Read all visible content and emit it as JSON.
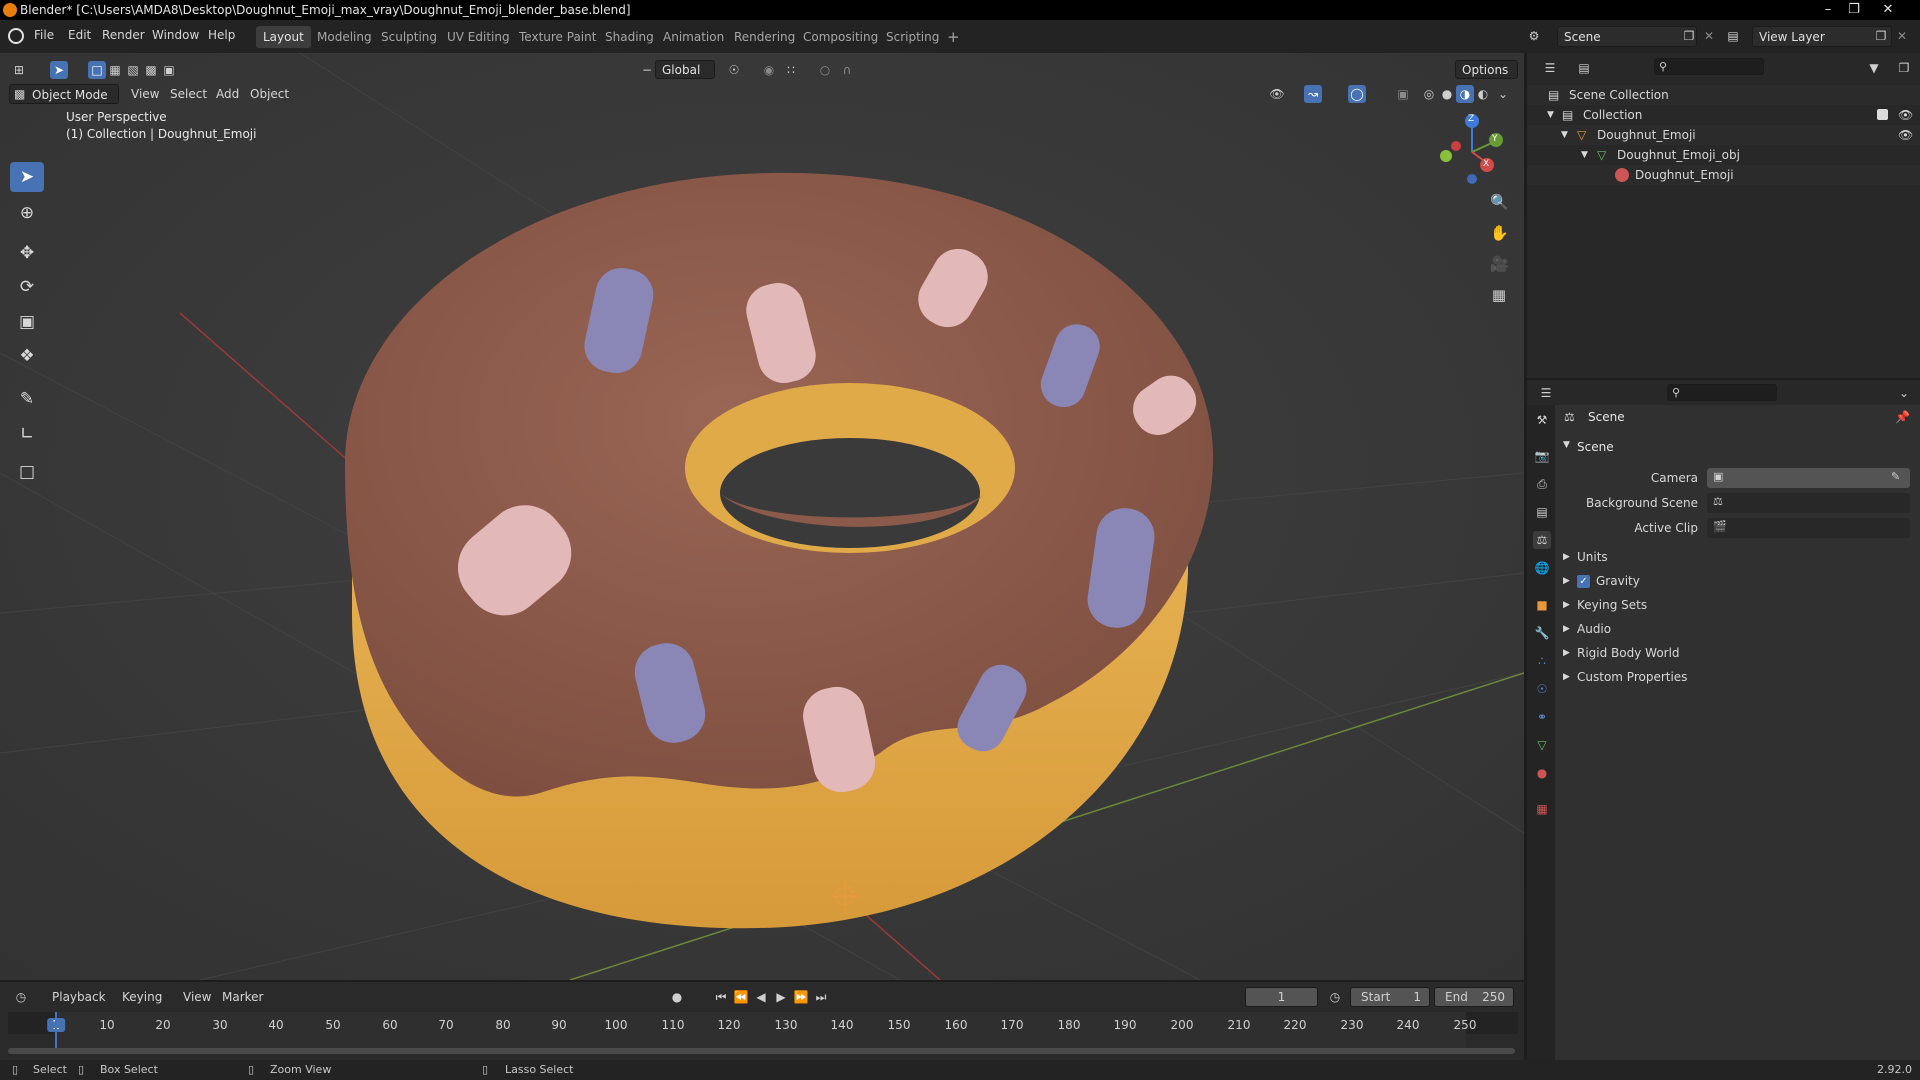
{
  "window": {
    "title": "Blender* [C:\\Users\\AMDA8\\Desktop\\Doughnut_Emoji_max_vray\\Doughnut_Emoji_blender_base.blend]",
    "minimize": "–",
    "maximize": "❐",
    "close": "✕"
  },
  "menu": {
    "items": [
      "File",
      "Edit",
      "Render",
      "Window",
      "Help"
    ]
  },
  "workspaces": [
    "Layout",
    "Modeling",
    "Sculpting",
    "UV Editing",
    "Texture Paint",
    "Shading",
    "Animation",
    "Rendering",
    "Compositing",
    "Scripting",
    "+"
  ],
  "scene_selector": {
    "value": "Scene",
    "viewlayer": "View Layer"
  },
  "viewport": {
    "orientation": "Global",
    "options_label": "Options",
    "mode": "Object Mode",
    "header_menus": [
      "View",
      "Select",
      "Add",
      "Object"
    ],
    "overlay_title": "User Perspective",
    "overlay_subtitle": "(1) Collection | Doughnut_Emoji",
    "gizmo": {
      "z": "Z",
      "y": "Y",
      "x": "X"
    }
  },
  "outliner": {
    "rows": [
      "Scene Collection",
      "Collection",
      "Doughnut_Emoji",
      "Doughnut_Emoji_obj",
      "Doughnut_Emoji"
    ]
  },
  "properties": {
    "context": "Scene",
    "section": "Scene",
    "fields": [
      {
        "label": "Camera",
        "value": ""
      },
      {
        "label": "Background Scene",
        "value": ""
      },
      {
        "label": "Active Clip",
        "value": ""
      }
    ],
    "panels": [
      "Units",
      "Gravity",
      "Keying Sets",
      "Audio",
      "Rigid Body World",
      "Custom Properties"
    ],
    "gravity_checked": true
  },
  "timeline": {
    "menus": [
      "Playback",
      "Keying",
      "View",
      "Marker"
    ],
    "current_frame": "1",
    "start_label": "Start",
    "start": "1",
    "end_label": "End",
    "end": "250",
    "ticks": [
      "1",
      "10",
      "20",
      "30",
      "40",
      "50",
      "60",
      "70",
      "80",
      "90",
      "100",
      "110",
      "120",
      "130",
      "140",
      "150",
      "160",
      "170",
      "180",
      "190",
      "200",
      "210",
      "220",
      "230",
      "240",
      "250"
    ]
  },
  "statusbar": {
    "items": [
      "Select",
      "Box Select",
      "Zoom View",
      "Lasso Select"
    ],
    "version": "2.92.0"
  },
  "colors": {
    "accent": "#4772b3",
    "donut_dough": "#e3ad4c",
    "icing": "#8c5a4a",
    "sprinkle_pink": "#e3b8b8",
    "sprinkle_purple": "#8a86b6",
    "viewport_bg": "#3a3a3a"
  }
}
